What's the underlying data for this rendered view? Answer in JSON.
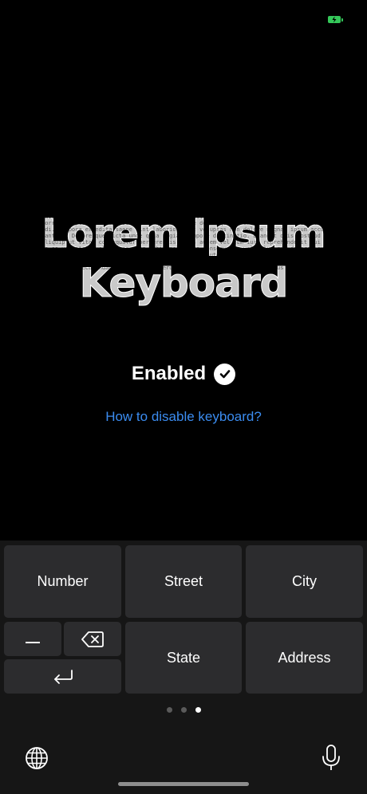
{
  "status_bar": {
    "battery_color": "#34c759",
    "battery_icon": "battery-charging-icon"
  },
  "hero": {
    "title_line1": "Lorem Ipsum",
    "title_line2": "Keyboard",
    "texture_text": "quis tempora aute hic fugit lorem et hic commodi voluptatem, eu velit ipsum deserunt porro voluptate magnam. Duis aute quam tempore dolor quis irure nulla hic velit commodi. Tempora expedita saepe sint laboriosam et voluptas non dolore magnam ipsum accusantium. Doloremque dicta unde quia fugiat tempore distinctio. Blandit quis nostrud aliquip ut vitae consequatur perferendis. Quis autem vel eum iure reprehenderit qui in ea voluptate velit esse quam nihil molestiae consequatur vel illum qui dolorem eum fugiat quo voluptas nulla pariatur. Temporibus autem quibusdam et aut officiis debitis aut rerum necessitatibus saepe eveniet ut et voluptates repudiandae sint et molestiae non recusandae itaque earum rerum hic tenetur a sapiente delectus"
  },
  "status": {
    "enabled_label": "Enabled",
    "check_icon": "checkmark-circle-icon"
  },
  "help": {
    "link_text": "How to disable keyboard?",
    "link_color": "#3b8cf0"
  },
  "keyboard": {
    "keys": {
      "number": "Number",
      "street": "Street",
      "city": "City",
      "state": "State",
      "address": "Address"
    },
    "icons": {
      "space": "space-underscore-icon",
      "delete": "delete-backspace-icon",
      "return": "return-arrow-icon",
      "globe": "globe-icon",
      "mic": "microphone-icon"
    },
    "page_indicator": {
      "pages": 3,
      "active_page": 3
    }
  }
}
